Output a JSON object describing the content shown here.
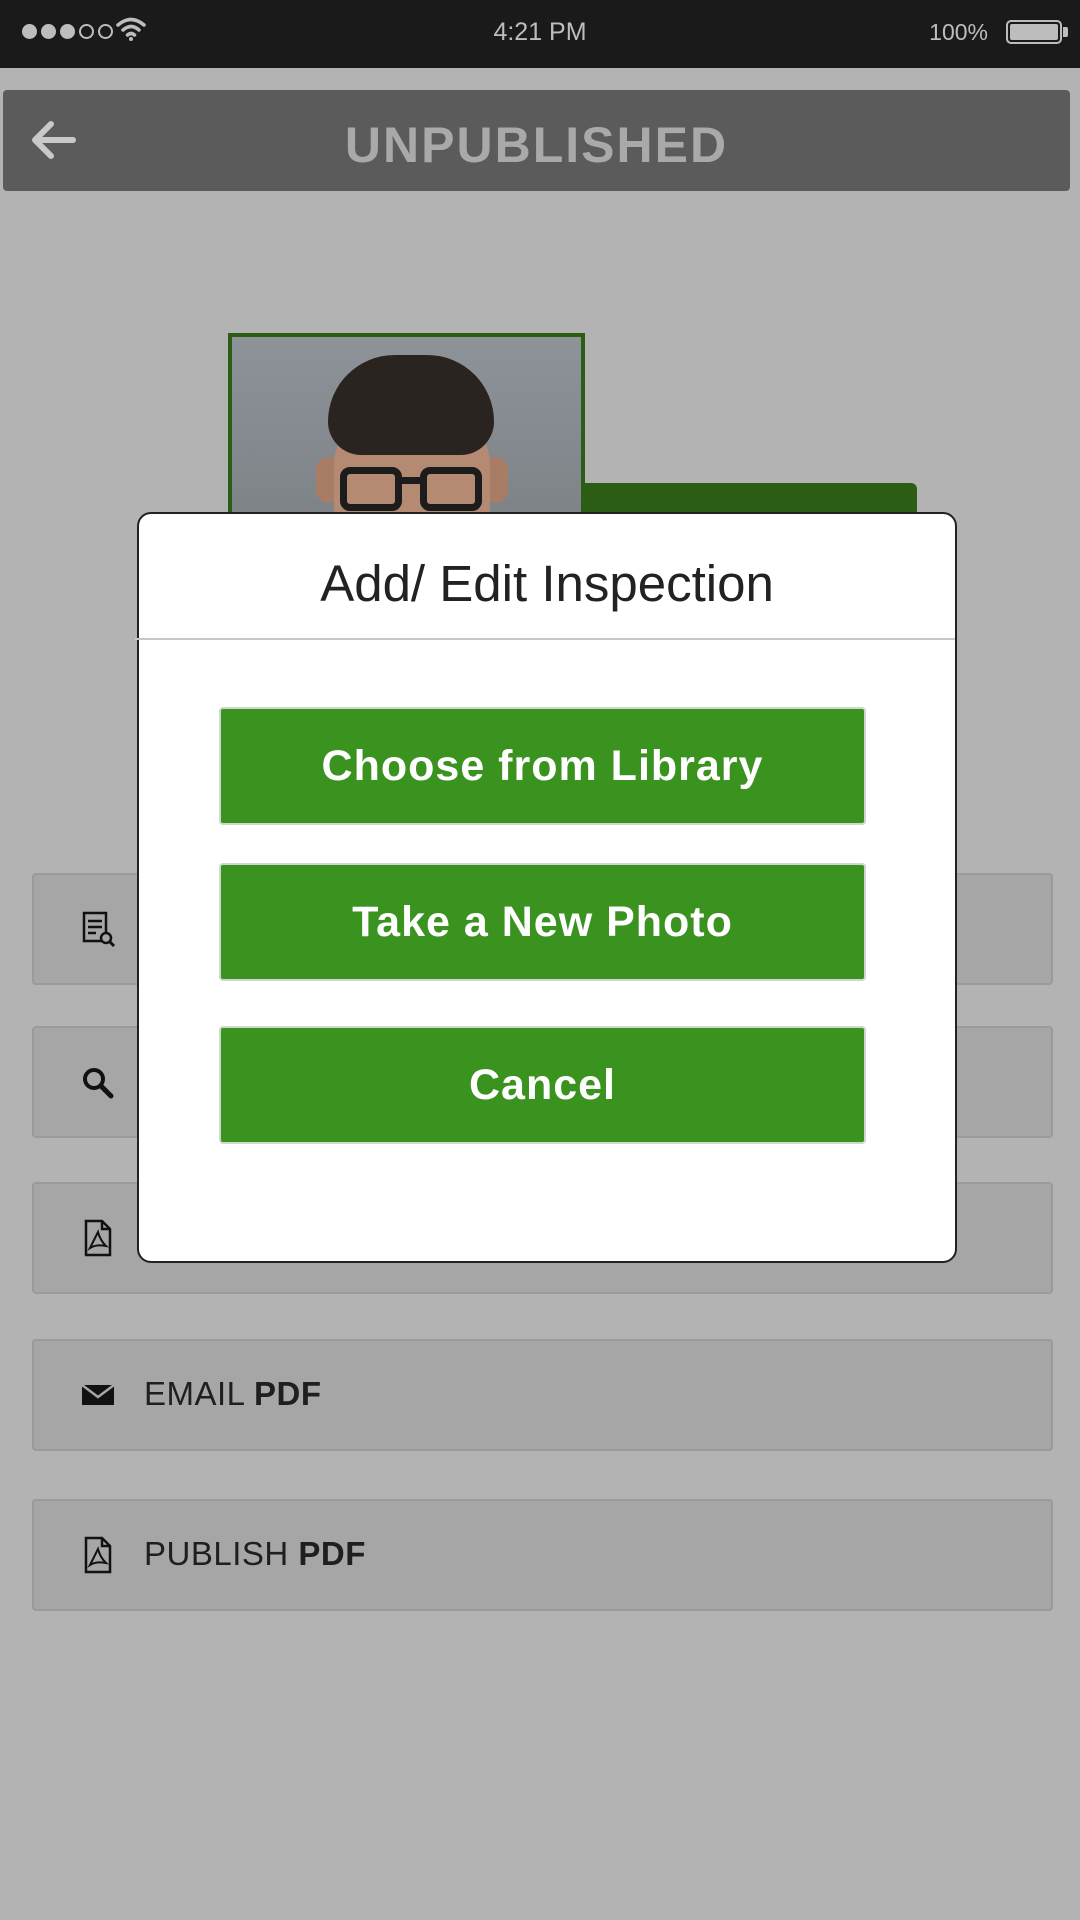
{
  "status_bar": {
    "time": "4:21 PM",
    "battery": "100%",
    "signal_bars_full": 3,
    "signal_bars_total": 5
  },
  "header": {
    "title": "UNPUBLISHED",
    "back_icon": "arrow-left-icon"
  },
  "rows": [
    {
      "icon": "document-search-icon",
      "label": "",
      "label_bold": ""
    },
    {
      "icon": "search-icon",
      "label": "",
      "label_bold": ""
    },
    {
      "icon": "pdf-icon",
      "label": "",
      "label_bold": ""
    },
    {
      "icon": "mail-icon",
      "label": "EMAIL ",
      "label_bold": "PDF"
    },
    {
      "icon": "pdf-icon",
      "label": "PUBLISH ",
      "label_bold": "PDF"
    }
  ],
  "modal": {
    "title": "Add/ Edit Inspection",
    "buttons": {
      "library": "Choose from Library",
      "new_photo": "Take a New Photo",
      "cancel": "Cancel"
    }
  },
  "colors": {
    "accent_green": "#3a921f",
    "dark_green": "#2c5d15",
    "header_gray": "#5b5b5b",
    "background_gray": "#b3b3b3"
  }
}
